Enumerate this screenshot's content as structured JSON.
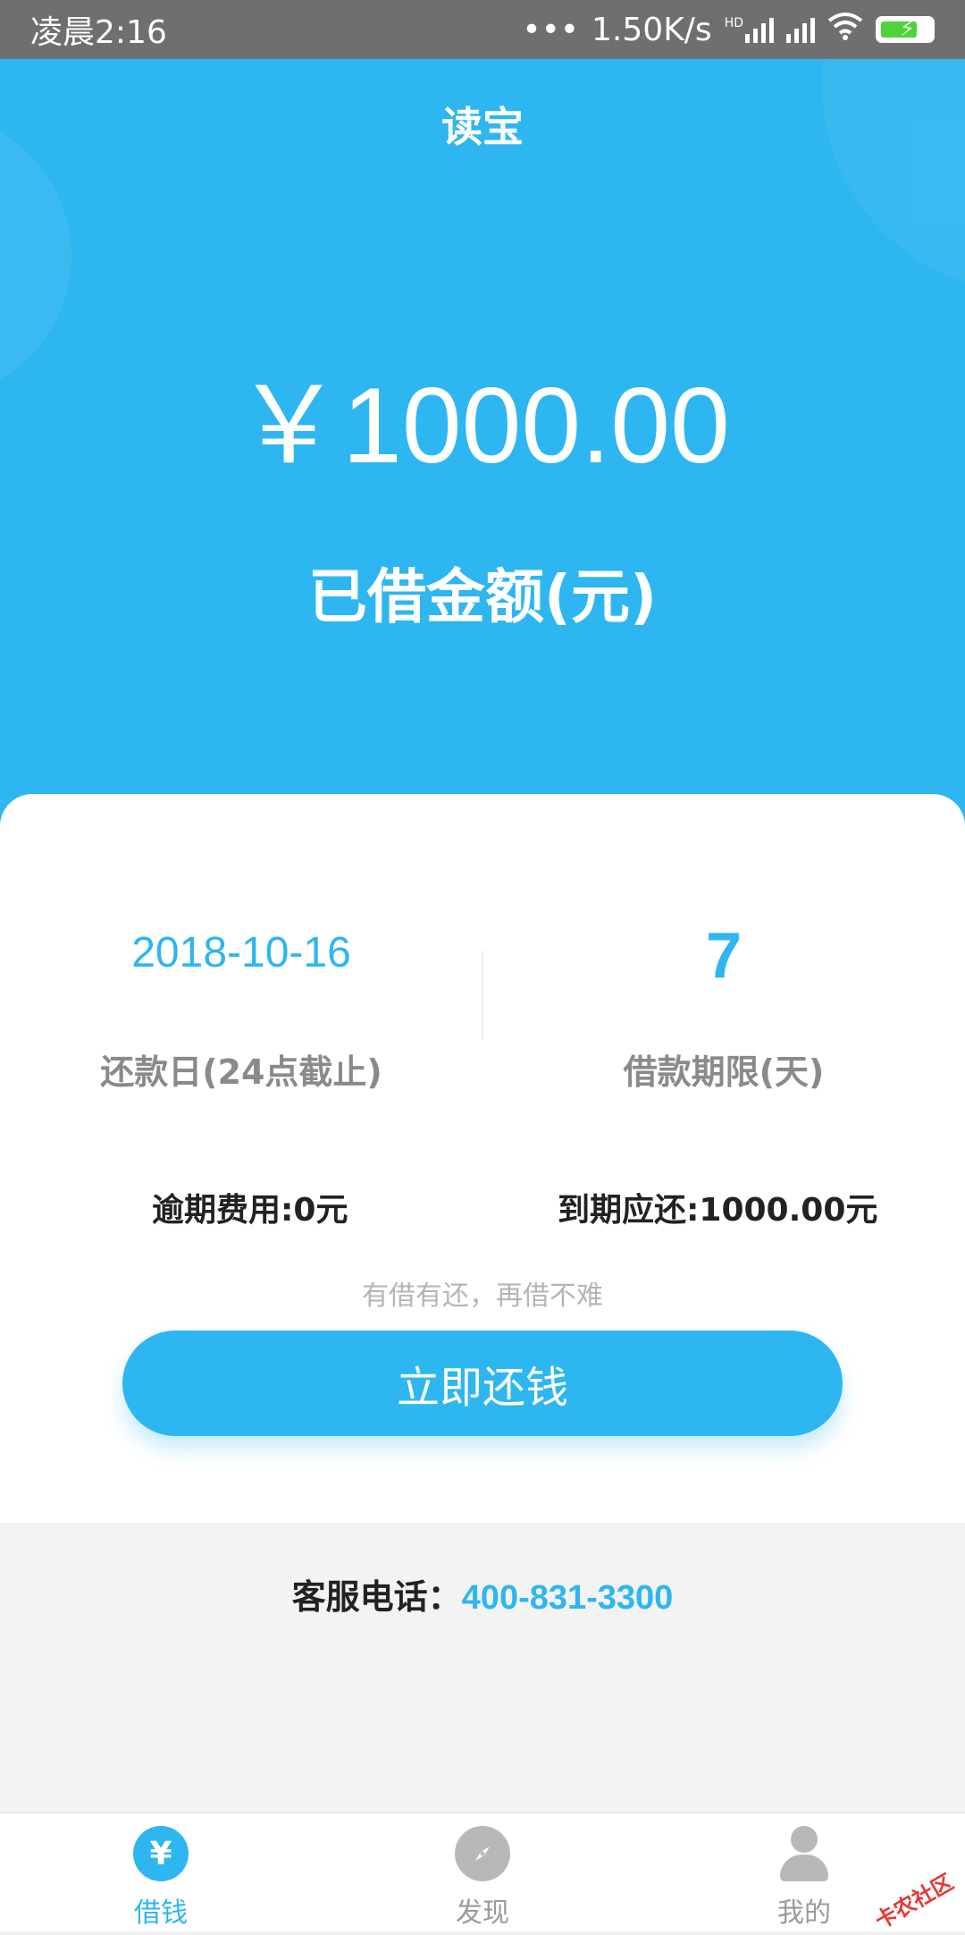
{
  "status_bar": {
    "time": "凌晨2:16",
    "dots": "•••",
    "speed": "1.50K/s",
    "hd": "HD"
  },
  "header": {
    "title": "读宝",
    "amount": "￥1000.00",
    "amount_label": "已借金额(元)"
  },
  "loan_info": {
    "due_date": "2018-10-16",
    "due_date_label": "还款日(24点截止)",
    "term": "7",
    "term_label": "借款期限(天)",
    "overdue_fee": "逾期费用:0元",
    "due_total": "到期应还:1000.00元",
    "slogan": "有借有还，再借不难",
    "repay_button": "立即还钱"
  },
  "service": {
    "label": "客服电话：",
    "phone": "400-831-3300"
  },
  "bottom_nav": {
    "items": [
      {
        "label": "借钱",
        "icon": "yen-icon",
        "active": true
      },
      {
        "label": "发现",
        "icon": "compass-icon",
        "active": false
      },
      {
        "label": "我的",
        "icon": "person-icon",
        "active": false
      }
    ]
  },
  "watermark": "卡农社区",
  "colors": {
    "accent": "#2eb6f0",
    "status_bar": "#6f6f6f",
    "background": "#f3f3f3"
  }
}
